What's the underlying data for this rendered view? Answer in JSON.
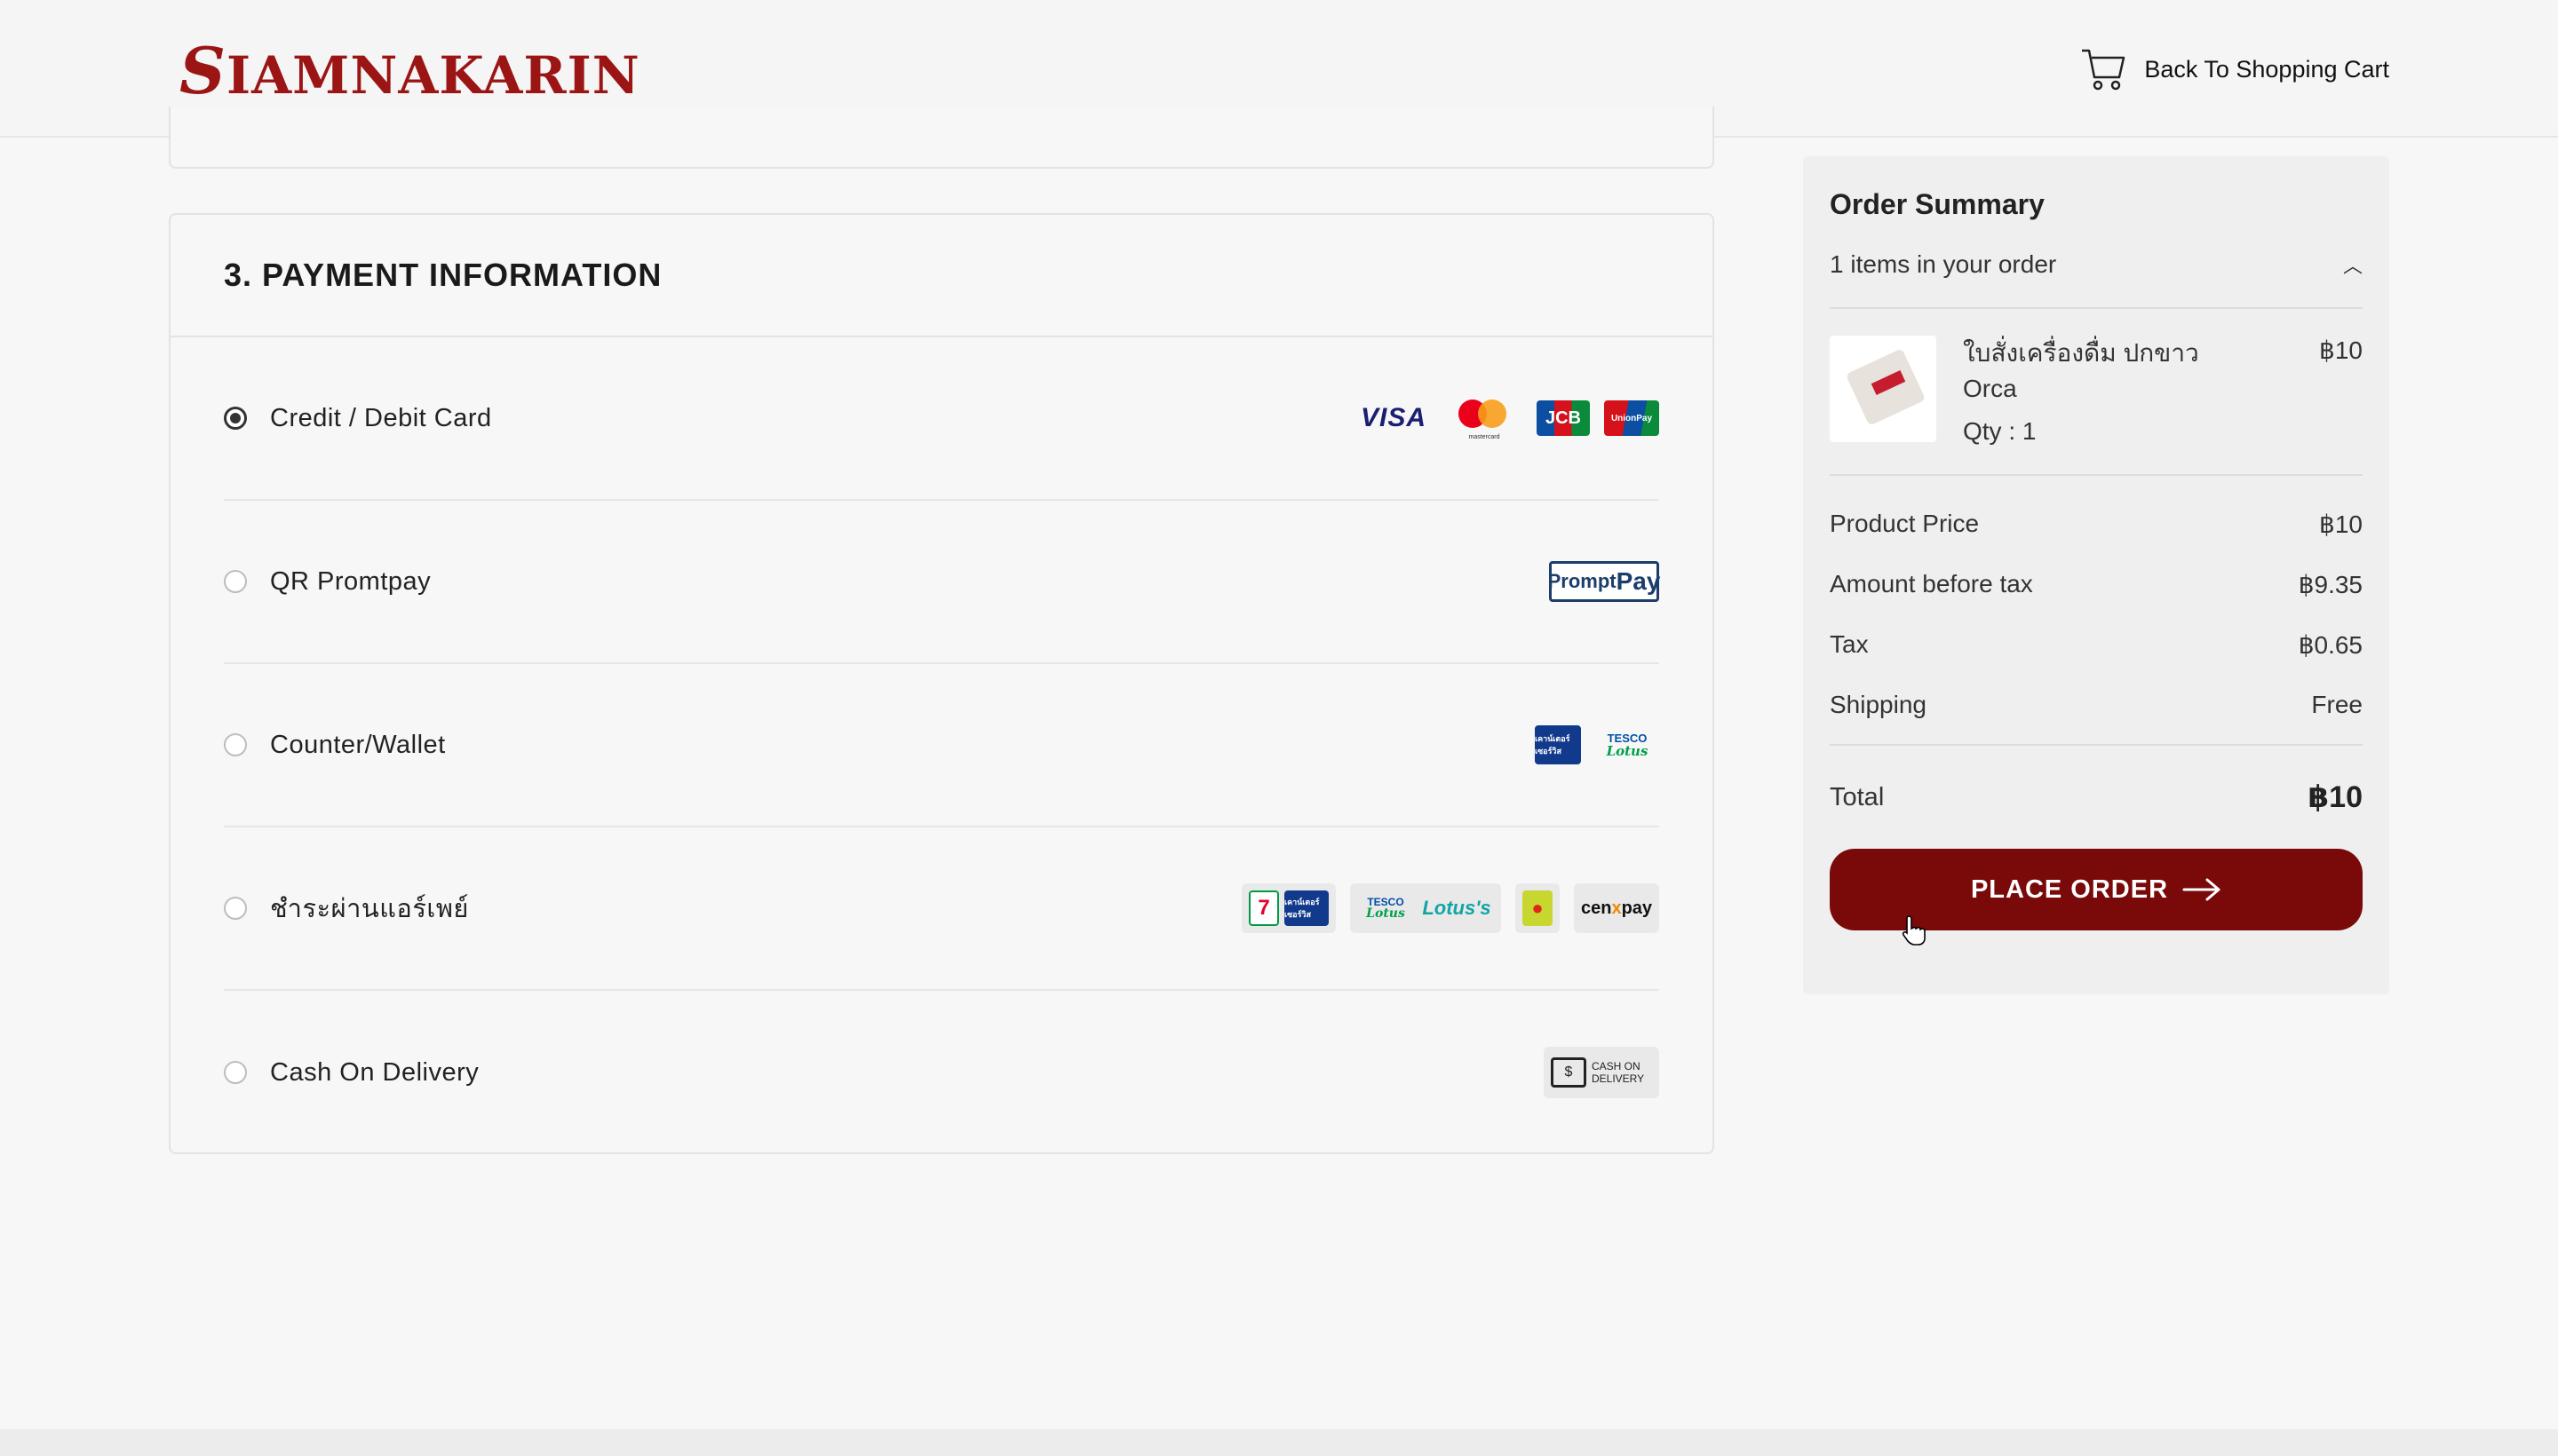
{
  "header": {
    "logo_text_initial": "S",
    "logo_text_rest": "IAMNAKARIN",
    "back_to_cart": "Back To Shopping Cart",
    "cart_icon": "shopping-cart-icon"
  },
  "payment": {
    "title": "3. PAYMENT INFORMATION",
    "methods": [
      {
        "label": "Credit / Debit Card",
        "selected": true
      },
      {
        "label": "QR Promtpay",
        "selected": false
      },
      {
        "label": "Counter/Wallet",
        "selected": false
      },
      {
        "label": "ชำระผ่านแอร์เพย์",
        "selected": false
      },
      {
        "label": "Cash On Delivery",
        "selected": false
      }
    ],
    "logos": {
      "visa": "VISA",
      "mastercard_caption": "mastercard",
      "jcb": "JCB",
      "unionpay": "UnionPay",
      "promptpay_a": "Prompt",
      "promptpay_b": "Pay",
      "counter_service": "เคาน์เตอร์ เซอร์วิส",
      "tesco_a": "TESCO",
      "tesco_b": "Lotus",
      "seven": "7",
      "lotuss": "Lotus's",
      "cenpay_a": "cen",
      "cenpay_b": "x",
      "cenpay_c": "pay",
      "cod_a": "CASH ON",
      "cod_b": "DELIVERY"
    }
  },
  "summary": {
    "title": "Order Summary",
    "items_count": "1 items in your order",
    "chevron_icon": "chevron-up-icon",
    "item": {
      "name_line1": "ใบสั่งเครื่องดื่ม ปกขาว",
      "name_line2": "Orca",
      "qty": "Qty : 1",
      "price": "฿10"
    },
    "lines": [
      {
        "label": "Product Price",
        "value": "฿10"
      },
      {
        "label": "Amount before tax",
        "value": "฿9.35"
      },
      {
        "label": "Tax",
        "value": "฿0.65"
      },
      {
        "label": "Shipping",
        "value": "Free"
      }
    ],
    "total_label": "Total",
    "total_value": "฿10",
    "place_order": "PLACE ORDER"
  },
  "colors": {
    "brand": "#9b1515",
    "button": "#7a0a0a",
    "background": "#f7f7f7"
  }
}
